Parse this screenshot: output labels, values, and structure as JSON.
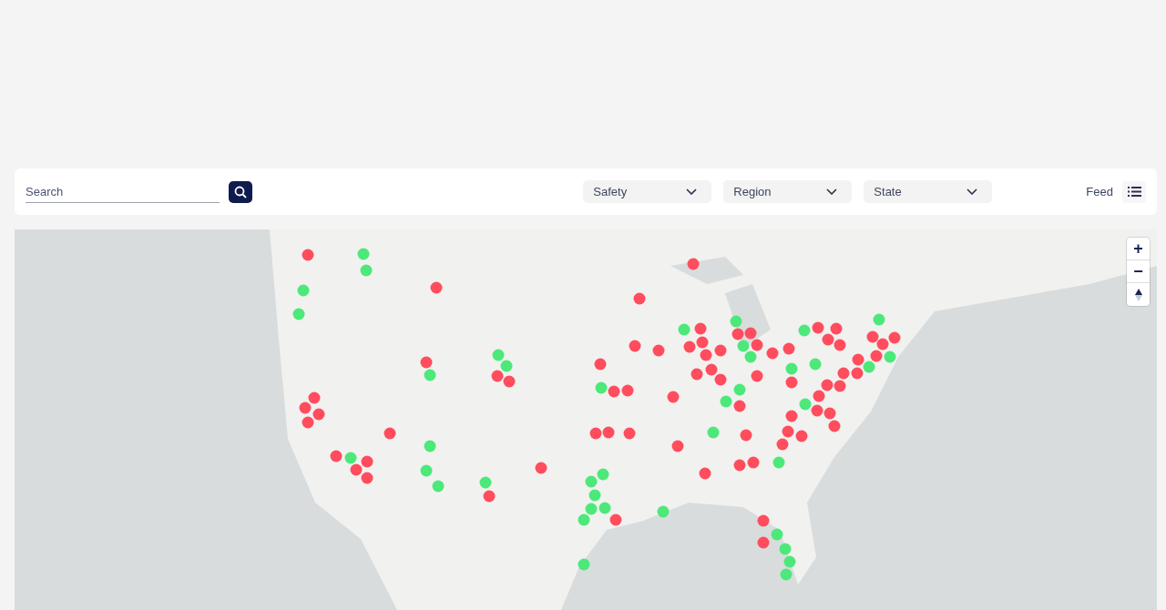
{
  "toolbar": {
    "search": {
      "placeholder": "Search"
    },
    "filters": [
      {
        "label": "Safety"
      },
      {
        "label": "Region"
      },
      {
        "label": "State"
      }
    ],
    "feed": {
      "label": "Feed"
    }
  },
  "map": {
    "zoom_controls": [
      {
        "kind": "zoom-in",
        "label": "+"
      },
      {
        "kind": "zoom-out",
        "label": "−"
      },
      {
        "kind": "compass"
      }
    ],
    "markers": [
      {
        "color": "#ff4d5e"
      },
      {
        "color": "#4de87a"
      },
      {
        "color": "#4de87a"
      },
      {
        "color": "#4de87a"
      },
      {
        "color": "#4de87a"
      },
      {
        "color": "#ff4d5e"
      },
      {
        "color": "#ff4d5e"
      },
      {
        "color": "#ff4d5e"
      },
      {
        "color": "#ff4d5e"
      },
      {
        "color": "#4de87a"
      },
      {
        "color": "#4de87a"
      },
      {
        "color": "#4de87a"
      },
      {
        "color": "#ff4d5e"
      },
      {
        "color": "#ff4d5e"
      },
      {
        "color": "#ff4d5e"
      },
      {
        "color": "#4de87a"
      },
      {
        "color": "#ff4d5e"
      },
      {
        "color": "#ff4d5e"
      },
      {
        "color": "#ff4d5e"
      },
      {
        "color": "#ff4d5e"
      },
      {
        "color": "#ff4d5e"
      },
      {
        "color": "#ff4d5e"
      },
      {
        "color": "#ff4d5e"
      },
      {
        "color": "#ff4d5e"
      },
      {
        "color": "#4de87a"
      },
      {
        "color": "#ff4d5e"
      },
      {
        "color": "#ff4d5e"
      },
      {
        "color": "#ff4d5e"
      },
      {
        "color": "#4de87a"
      },
      {
        "color": "#4de87a"
      },
      {
        "color": "#4de87a"
      },
      {
        "color": "#4de87a"
      },
      {
        "color": "#ff4d5e"
      },
      {
        "color": "#ff4d5e"
      },
      {
        "color": "#ff4d5e"
      },
      {
        "color": "#ff4d5e"
      },
      {
        "color": "#ff4d5e"
      },
      {
        "color": "#ff4d5e"
      },
      {
        "color": "#4de87a"
      },
      {
        "color": "#4de87a"
      },
      {
        "color": "#4de87a"
      },
      {
        "color": "#4de87a"
      },
      {
        "color": "#4de87a"
      },
      {
        "color": "#4de87a"
      },
      {
        "color": "#ff4d5e"
      },
      {
        "color": "#4de87a"
      },
      {
        "color": "#4de87a"
      },
      {
        "color": "#ff4d5e"
      },
      {
        "color": "#ff4d5e"
      },
      {
        "color": "#ff4d5e"
      },
      {
        "color": "#ff4d5e"
      },
      {
        "color": "#ff4d5e"
      },
      {
        "color": "#ff4d5e"
      },
      {
        "color": "#ff4d5e"
      },
      {
        "color": "#4de87a"
      },
      {
        "color": "#ff4d5e"
      },
      {
        "color": "#ff4d5e"
      },
      {
        "color": "#ff4d5e"
      },
      {
        "color": "#ff4d5e"
      },
      {
        "color": "#4de87a"
      },
      {
        "color": "#ff4d5e"
      },
      {
        "color": "#ff4d5e"
      },
      {
        "color": "#4de87a"
      },
      {
        "color": "#ff4d5e"
      },
      {
        "color": "#4de87a"
      },
      {
        "color": "#ff4d5e"
      },
      {
        "color": "#ff4d5e"
      },
      {
        "color": "#4de87a"
      },
      {
        "color": "#4de87a"
      },
      {
        "color": "#ff4d5e"
      },
      {
        "color": "#4de87a"
      },
      {
        "color": "#ff4d5e"
      },
      {
        "color": "#ff4d5e"
      },
      {
        "color": "#ff4d5e"
      },
      {
        "color": "#ff4d5e"
      },
      {
        "color": "#4de87a"
      },
      {
        "color": "#ff4d5e"
      },
      {
        "color": "#ff4d5e"
      },
      {
        "color": "#ff4d5e"
      },
      {
        "color": "#ff4d5e"
      },
      {
        "color": "#4de87a"
      },
      {
        "color": "#ff4d5e"
      },
      {
        "color": "#4de87a"
      },
      {
        "color": "#4de87a"
      },
      {
        "color": "#ff4d5e"
      },
      {
        "color": "#4de87a"
      },
      {
        "color": "#ff4d5e"
      },
      {
        "color": "#ff4d5e"
      },
      {
        "color": "#ff4d5e"
      },
      {
        "color": "#ff4d5e"
      },
      {
        "color": "#4de87a"
      },
      {
        "color": "#ff4d5e"
      },
      {
        "color": "#ff4d5e"
      },
      {
        "color": "#ff4d5e"
      },
      {
        "color": "#4de87a"
      },
      {
        "color": "#ff4d5e"
      },
      {
        "color": "#4de87a"
      },
      {
        "color": "#ff4d5e"
      },
      {
        "color": "#ff4d5e"
      },
      {
        "color": "#ff4d5e"
      },
      {
        "color": "#ff4d5e"
      },
      {
        "color": "#ff4d5e"
      },
      {
        "color": "#ff4d5e"
      },
      {
        "color": "#ff4d5e"
      },
      {
        "color": "#ff4d5e"
      },
      {
        "color": "#ff4d5e"
      },
      {
        "color": "#ff4d5e"
      },
      {
        "color": "#4de87a"
      },
      {
        "color": "#ff4d5e"
      },
      {
        "color": "#4de87a"
      },
      {
        "color": "#4de87a"
      },
      {
        "color": "#4de87a"
      }
    ]
  }
}
